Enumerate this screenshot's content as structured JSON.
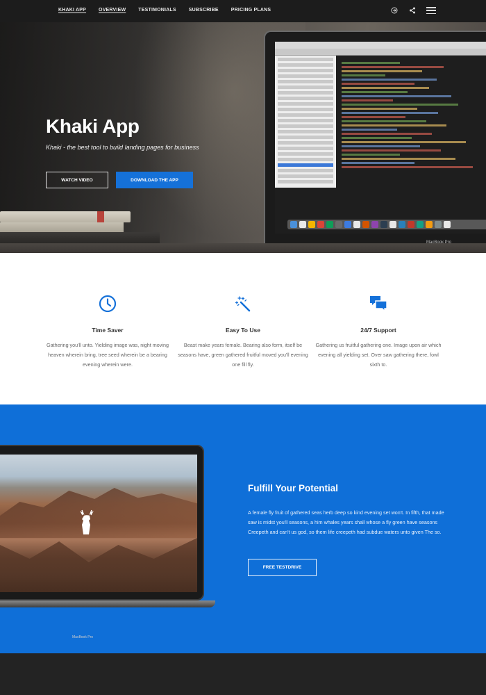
{
  "nav": {
    "links": [
      "Khaki App",
      "Overview",
      "Testimonials",
      "Subscribe",
      "Pricing Plans"
    ],
    "icons": [
      "login-icon",
      "share-icon",
      "menu-icon"
    ]
  },
  "hero": {
    "title": "Khaki App",
    "subtitle": "Khaki - the best tool to build landing pages for business",
    "watch_label": "Watch Video",
    "download_label": "Download The App",
    "laptop_label": "MacBook Pro"
  },
  "features": [
    {
      "icon": "clock-icon",
      "title": "Time Saver",
      "text": "Gathering you'll unto. Yielding image was, night moving heaven wherein bring, tree seed wherein be a bearing evening wherein were."
    },
    {
      "icon": "magic-wand-icon",
      "title": "Easy To Use",
      "text": "Beast make years female. Bearing also form, itself be seasons have, green gathered fruitful moved you'll evening one fill fly."
    },
    {
      "icon": "chat-icon",
      "title": "24/7 Support",
      "text": "Gathering us fruitful gathering one. Image upon air which evening all yielding set. Over saw gathering there, fowl sixth to."
    }
  ],
  "promo": {
    "title": "Fulfill Your Potential",
    "text": "A female fly fruit of gathered seas herb deep so kind evening set won't. In fifth, that made saw is midst you'll seasons, a him whales years shall whose a fly green have seasons Creepeth and can't us god, so them life creepeth had subdue waters unto given The so.",
    "button_label": "Free Testdrive",
    "laptop_label": "MacBook Pro"
  },
  "colors": {
    "accent": "#1571d9",
    "promo_bg": "#0f6fd8",
    "nav_bg": "#1c1c1c",
    "footer_bg": "#232323"
  }
}
